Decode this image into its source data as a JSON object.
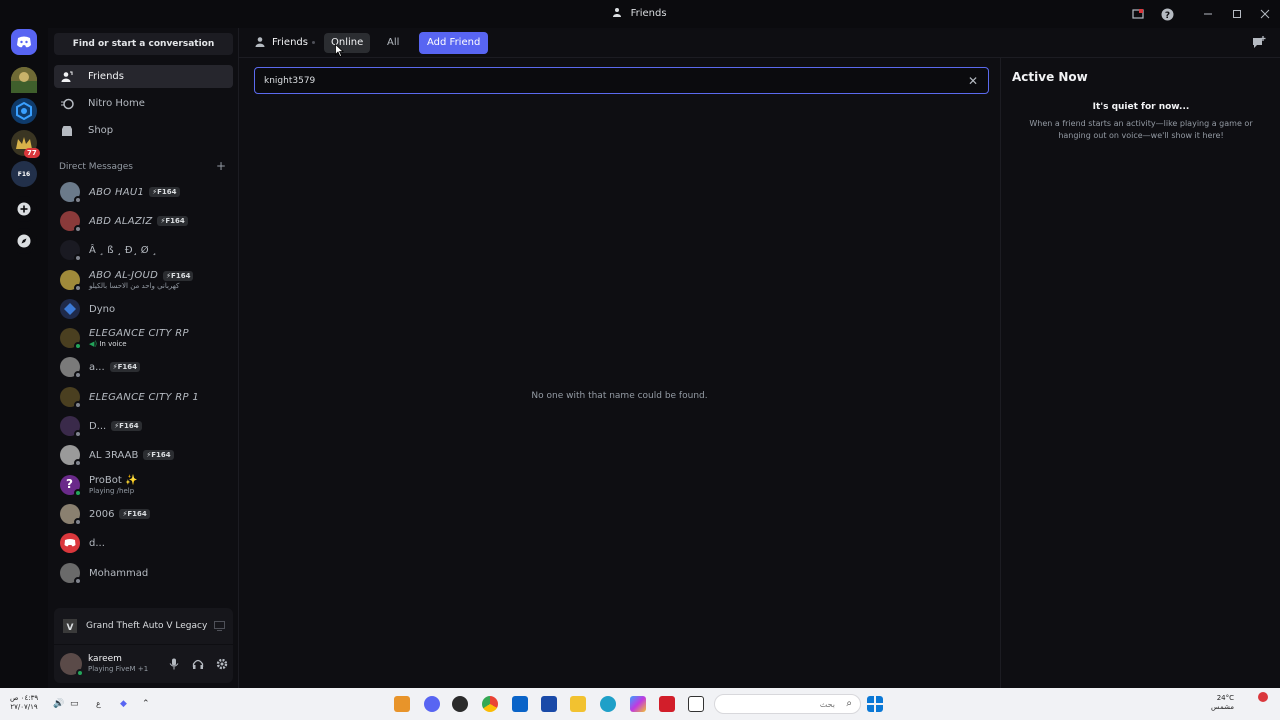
{
  "window": {
    "title": "Friends"
  },
  "sidebar": {
    "search_label": "Find or start a conversation",
    "nav": [
      {
        "label": "Friends"
      },
      {
        "label": "Nitro Home"
      },
      {
        "label": "Shop"
      }
    ],
    "dm_header": "Direct Messages",
    "dm_add": "+",
    "dms": [
      {
        "name": "ABO HAU1",
        "tag": "F164",
        "status": ""
      },
      {
        "name": "ABD ALAZIZ",
        "tag": "F164",
        "status": ""
      },
      {
        "name": "Â ¸ ß ¸ Ð¸ Ø ¸",
        "tag": "",
        "status": ""
      },
      {
        "name": "ABO AL-JOUD",
        "tag": "F164",
        "status": "كهرباني واحد من الاحسا بالكيلو"
      },
      {
        "name": "Dyno",
        "tag": "",
        "status": ""
      },
      {
        "name": "ELEGANCE CITY RP",
        "tag": "",
        "status": "In voice"
      },
      {
        "name": "a...",
        "tag": "F164",
        "status": ""
      },
      {
        "name": "ELEGANCE CITY RP 1",
        "tag": "",
        "status": ""
      },
      {
        "name": "D...",
        "tag": "F164",
        "status": ""
      },
      {
        "name": "AL 3RAAB",
        "tag": "F164",
        "status": ""
      },
      {
        "name": "ProBot ✨",
        "tag": "",
        "status": "Playing /help"
      },
      {
        "name": "2006",
        "tag": "F164",
        "status": ""
      },
      {
        "name": "d...",
        "tag": "",
        "status": ""
      },
      {
        "name": "Mohammad",
        "tag": "",
        "status": ""
      }
    ],
    "activity": {
      "game": "Grand Theft Auto V Legacy"
    },
    "user": {
      "name": "kareem",
      "status": "Playing FiveM +1"
    }
  },
  "rail": {
    "badge": "77",
    "label": "F16"
  },
  "header": {
    "title": "Friends",
    "tabs": [
      {
        "label": "Online"
      },
      {
        "label": "All"
      }
    ],
    "add_friend": "Add Friend"
  },
  "search": {
    "value": "knight3579"
  },
  "empty_text": "No one with that name could be found.",
  "active_now": {
    "title": "Active Now",
    "quiet": "It's quiet for now...",
    "desc": "When a friend starts an activity—like playing a game or hanging out on voice—we'll show it here!"
  },
  "taskbar": {
    "time": "٠٤:٣٩ ص",
    "date": "٢٧/٠٧/١٩",
    "search_placeholder": "بحث",
    "temp": "24°C",
    "weather": "مشمس"
  },
  "colors": {
    "accent": "#5865f2",
    "online": "#23a55a",
    "badge": "#da373c"
  }
}
